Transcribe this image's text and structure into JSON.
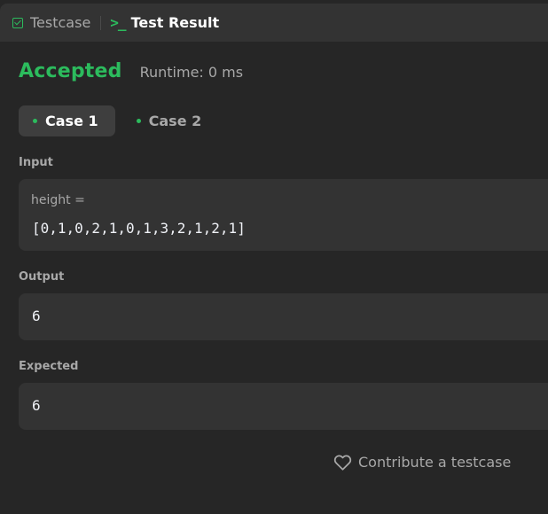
{
  "tabs": {
    "testcase_label": "Testcase",
    "result_label": "Test Result",
    "result_icon": ">_"
  },
  "status": {
    "verdict": "Accepted",
    "runtime": "Runtime: 0 ms"
  },
  "cases": [
    {
      "label": "Case 1"
    },
    {
      "label": "Case 2"
    }
  ],
  "input": {
    "label": "Input",
    "var_name": "height =",
    "value": "[0,1,0,2,1,0,1,3,2,1,2,1]"
  },
  "output": {
    "label": "Output",
    "value": "6"
  },
  "expected": {
    "label": "Expected",
    "value": "6"
  },
  "contribute": {
    "label": "Contribute a testcase"
  },
  "colors": {
    "accent": "#2cbb5d",
    "background": "#262626",
    "panel": "#333333"
  }
}
